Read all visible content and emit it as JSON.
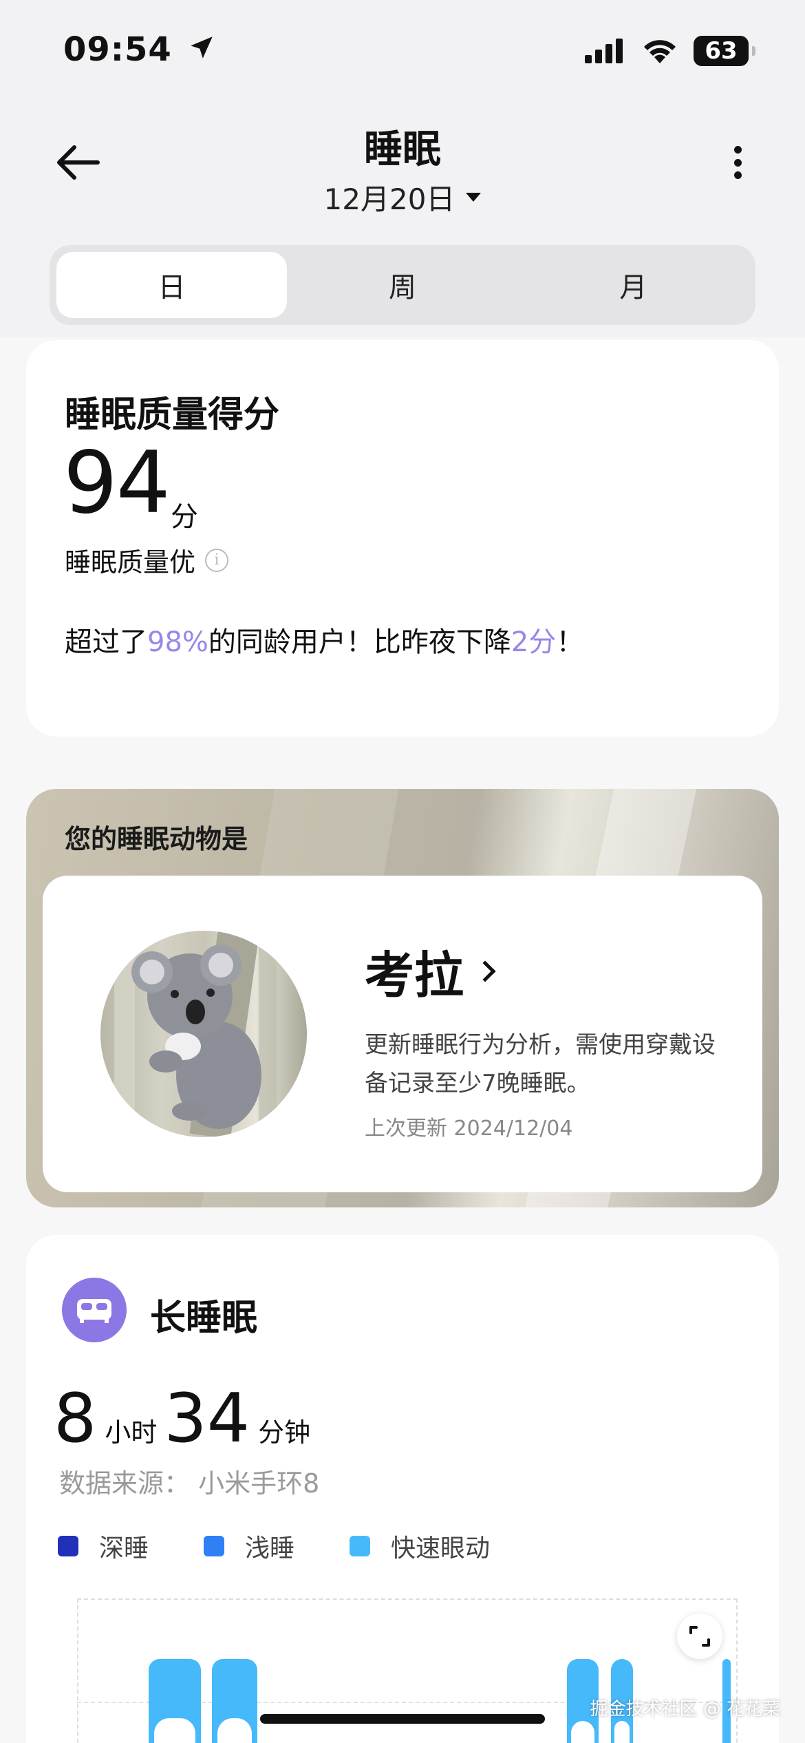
{
  "status_bar": {
    "time": "09:54",
    "battery": "63"
  },
  "header": {
    "title": "睡眠",
    "date": "12月20日"
  },
  "tabs": [
    {
      "label": "日",
      "active": true
    },
    {
      "label": "周",
      "active": false
    },
    {
      "label": "月",
      "active": false
    }
  ],
  "score": {
    "title": "睡眠质量得分",
    "value": "94",
    "unit": "分",
    "quality_label": "睡眠质量优",
    "compare_prefix": "超过了",
    "compare_percent": "98%",
    "compare_middle": "的同龄用户！比昨夜下降",
    "compare_drop": "2分",
    "compare_suffix": "！",
    "accent_color": "#9a86e8"
  },
  "animal": {
    "heading": "您的睡眠动物是",
    "name": "考拉",
    "description": "更新睡眠行为分析，需使用穿戴设备记录至少7晚睡眠。",
    "updated": "上次更新 2024/12/04"
  },
  "long_sleep": {
    "title": "长睡眠",
    "hours": "8",
    "hours_unit": "小时",
    "minutes": "34",
    "minutes_unit": "分钟",
    "source": "数据来源：  小米手环8",
    "icon_color": "#8c77e4",
    "legend": [
      {
        "label": "深睡",
        "color": "#2130b8"
      },
      {
        "label": "浅睡",
        "color": "#2f7ff5"
      },
      {
        "label": "快速眼动",
        "color": "#46b9fb"
      }
    ]
  },
  "watermark": "掘金技术社区 @ 花花菜"
}
